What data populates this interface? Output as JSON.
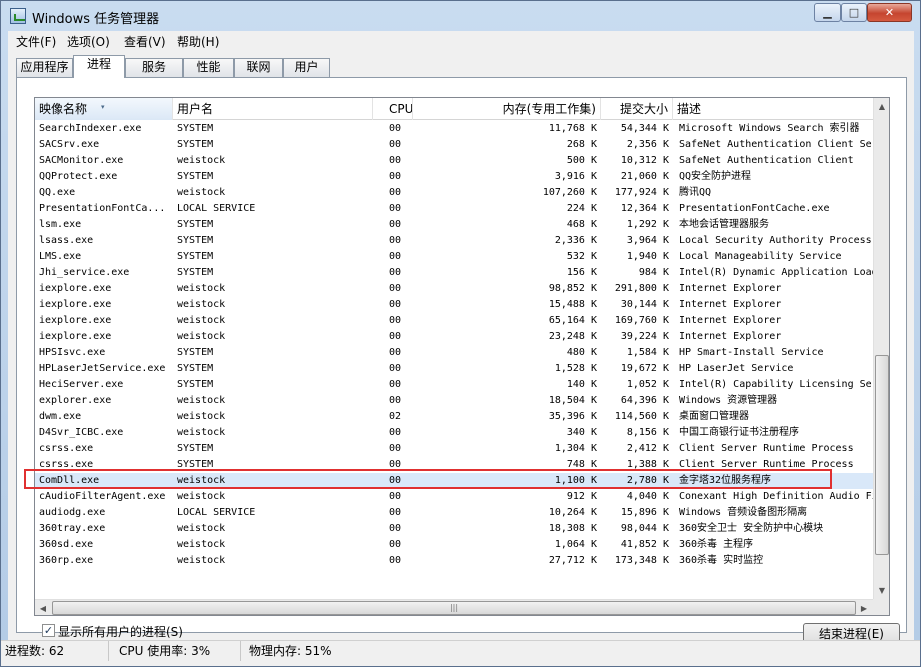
{
  "window": {
    "title": "Windows 任务管理器",
    "min_glyph": "▁",
    "max_glyph": "□",
    "close_glyph": "✕"
  },
  "menu": [
    "文件(F)",
    "选项(O)",
    "查看(V)",
    "帮助(H)"
  ],
  "tabs": [
    "应用程序",
    "进程",
    "服务",
    "性能",
    "联网",
    "用户"
  ],
  "active_tab": "进程",
  "columns": {
    "image": "映像名称",
    "user": "用户名",
    "cpu": "CPU",
    "memory": "内存(专用工作集)",
    "commit": "提交大小",
    "desc": "描述"
  },
  "processes": [
    {
      "image": "SearchIndexer.exe",
      "user": "SYSTEM",
      "cpu": "00",
      "mem": "11,768 K",
      "commit": "54,344 K",
      "desc": "Microsoft Windows Search 索引器"
    },
    {
      "image": "SACSrv.exe",
      "user": "SYSTEM",
      "cpu": "00",
      "mem": "268 K",
      "commit": "2,356 K",
      "desc": "SafeNet Authentication Client Service"
    },
    {
      "image": "SACMonitor.exe",
      "user": "weistock",
      "cpu": "00",
      "mem": "500 K",
      "commit": "10,312 K",
      "desc": "SafeNet Authentication Client"
    },
    {
      "image": "QQProtect.exe",
      "user": "SYSTEM",
      "cpu": "00",
      "mem": "3,916 K",
      "commit": "21,060 K",
      "desc": "QQ安全防护进程"
    },
    {
      "image": "QQ.exe",
      "user": "weistock",
      "cpu": "00",
      "mem": "107,260 K",
      "commit": "177,924 K",
      "desc": "腾讯QQ"
    },
    {
      "image": "PresentationFontCa...",
      "user": "LOCAL SERVICE",
      "cpu": "00",
      "mem": "224 K",
      "commit": "12,364 K",
      "desc": "PresentationFontCache.exe"
    },
    {
      "image": "lsm.exe",
      "user": "SYSTEM",
      "cpu": "00",
      "mem": "468 K",
      "commit": "1,292 K",
      "desc": "本地会话管理器服务"
    },
    {
      "image": "lsass.exe",
      "user": "SYSTEM",
      "cpu": "00",
      "mem": "2,336 K",
      "commit": "3,964 K",
      "desc": "Local Security Authority Process"
    },
    {
      "image": "LMS.exe",
      "user": "SYSTEM",
      "cpu": "00",
      "mem": "532 K",
      "commit": "1,940 K",
      "desc": "Local Manageability Service"
    },
    {
      "image": "Jhi_service.exe",
      "user": "SYSTEM",
      "cpu": "00",
      "mem": "156 K",
      "commit": "984 K",
      "desc": "Intel(R) Dynamic Application Loader Host Interface"
    },
    {
      "image": "iexplore.exe",
      "user": "weistock",
      "cpu": "00",
      "mem": "98,852 K",
      "commit": "291,800 K",
      "desc": "Internet Explorer"
    },
    {
      "image": "iexplore.exe",
      "user": "weistock",
      "cpu": "00",
      "mem": "15,488 K",
      "commit": "30,144 K",
      "desc": "Internet Explorer"
    },
    {
      "image": "iexplore.exe",
      "user": "weistock",
      "cpu": "00",
      "mem": "65,164 K",
      "commit": "169,760 K",
      "desc": "Internet Explorer"
    },
    {
      "image": "iexplore.exe",
      "user": "weistock",
      "cpu": "00",
      "mem": "23,248 K",
      "commit": "39,224 K",
      "desc": "Internet Explorer"
    },
    {
      "image": "HPSIsvc.exe",
      "user": "SYSTEM",
      "cpu": "00",
      "mem": "480 K",
      "commit": "1,584 K",
      "desc": "HP Smart-Install Service"
    },
    {
      "image": "HPLaserJetService.exe",
      "user": "SYSTEM",
      "cpu": "00",
      "mem": "1,528 K",
      "commit": "19,672 K",
      "desc": "HP LaserJet Service"
    },
    {
      "image": "HeciServer.exe",
      "user": "SYSTEM",
      "cpu": "00",
      "mem": "140 K",
      "commit": "1,052 K",
      "desc": "Intel(R) Capability Licensing Service"
    },
    {
      "image": "explorer.exe",
      "user": "weistock",
      "cpu": "00",
      "mem": "18,504 K",
      "commit": "64,396 K",
      "desc": "Windows 资源管理器"
    },
    {
      "image": "dwm.exe",
      "user": "weistock",
      "cpu": "02",
      "mem": "35,396 K",
      "commit": "114,560 K",
      "desc": "桌面窗口管理器"
    },
    {
      "image": "D4Svr_ICBC.exe",
      "user": "weistock",
      "cpu": "00",
      "mem": "340 K",
      "commit": "8,156 K",
      "desc": "中国工商银行证书注册程序"
    },
    {
      "image": "csrss.exe",
      "user": "SYSTEM",
      "cpu": "00",
      "mem": "1,304 K",
      "commit": "2,412 K",
      "desc": "Client Server Runtime Process"
    },
    {
      "image": "csrss.exe",
      "user": "SYSTEM",
      "cpu": "00",
      "mem": "748 K",
      "commit": "1,388 K",
      "desc": "Client Server Runtime Process"
    },
    {
      "image": "ComDll.exe",
      "user": "weistock",
      "cpu": "00",
      "mem": "1,100 K",
      "commit": "2,780 K",
      "desc": "金字塔32位服务程序",
      "selected": true
    },
    {
      "image": "cAudioFilterAgent.exe",
      "user": "weistock",
      "cpu": "00",
      "mem": "912 K",
      "commit": "4,040 K",
      "desc": "Conexant High Definition Audio Filter Agent"
    },
    {
      "image": "audiodg.exe",
      "user": "LOCAL SERVICE",
      "cpu": "00",
      "mem": "10,264 K",
      "commit": "15,896 K",
      "desc": "Windows 音频设备图形隔离"
    },
    {
      "image": "360tray.exe",
      "user": "weistock",
      "cpu": "00",
      "mem": "18,308 K",
      "commit": "98,044 K",
      "desc": "360安全卫士 安全防护中心模块"
    },
    {
      "image": "360sd.exe",
      "user": "weistock",
      "cpu": "00",
      "mem": "1,064 K",
      "commit": "41,852 K",
      "desc": "360杀毒 主程序"
    },
    {
      "image": "360rp.exe",
      "user": "weistock",
      "cpu": "00",
      "mem": "27,712 K",
      "commit": "173,348 K",
      "desc": "360杀毒 实时监控"
    }
  ],
  "show_all_users": {
    "label": "显示所有用户的进程(S)",
    "checked": true,
    "check_glyph": "✓"
  },
  "end_process_button": "结束进程(E)",
  "status": {
    "process_count": "进程数: 62",
    "cpu_usage": "CPU 使用率: 3%",
    "physical_memory": "物理内存: 51%"
  },
  "highlight_color": "#e03030",
  "selection_color": "#d9e8f9",
  "icons": {
    "sort": "▾",
    "scroll_up": "▲",
    "scroll_down": "▼",
    "scroll_left": "◀",
    "scroll_right": "▶",
    "grip": "|||"
  }
}
